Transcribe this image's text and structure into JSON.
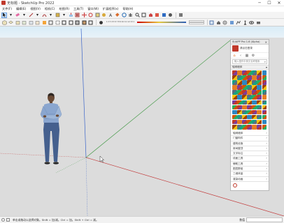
{
  "window": {
    "title": "无标题 - SketchUp Pro 2022",
    "minimize": "─",
    "maximize": "☐",
    "close": "✕"
  },
  "menu": [
    "文件(F)",
    "编辑(E)",
    "视图(V)",
    "相机(C)",
    "绘图(R)",
    "工具(T)",
    "窗口(W)",
    "扩展程序(x)",
    "帮助(H)"
  ],
  "toolbar": {
    "ruler_text": "1 2 3 4 5 6 7 8 9 10 11 12 13 14"
  },
  "tray": {
    "title": "SUAPP Pro 1.6 (Alpha)",
    "close": "×",
    "profile_name": "请点击登录",
    "search_placeholder": "输入插件中英文名称搜索",
    "section_label": "轴网墙体",
    "panes": [
      "轴网墙体",
      "门窗构件",
      "建筑设施",
      "房间屋顶",
      "文字标注",
      "线面工具",
      "辅助工具",
      "图层群组",
      "三维体量",
      "渲染动画"
    ]
  },
  "status": {
    "message": "单击或拖动以选择对象。Shift = 加/减。Ctrl = 加。Shift + Ctrl = 减。",
    "measure_label": "数值"
  },
  "colors": {
    "axis_red": "#c23b3b",
    "axis_green": "#4f9e52",
    "axis_blue": "#3a64c9",
    "sky": "#d9ecf7",
    "ground": "#dcdcdc"
  }
}
